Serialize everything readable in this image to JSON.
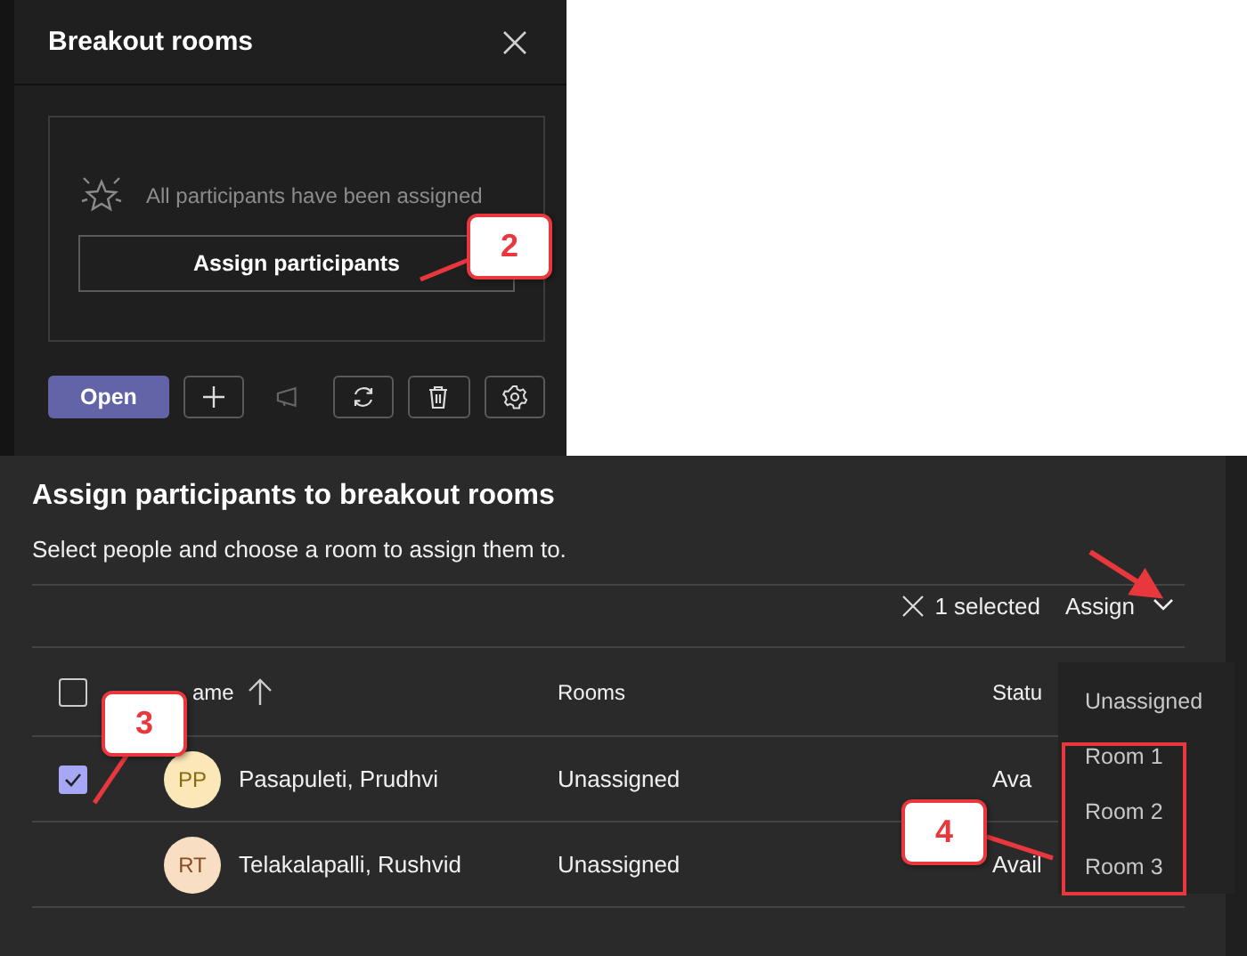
{
  "breakout_panel": {
    "title": "Breakout rooms",
    "empty_message": "All participants have been assigned",
    "assign_button": "Assign participants",
    "open_button": "Open"
  },
  "assign_dialog": {
    "title": "Assign participants to breakout rooms",
    "subtitle": "Select people and choose a room to assign them to.",
    "selection_count": "1 selected",
    "assign_button": "Assign",
    "select_all_checked": false,
    "columns": [
      "ame",
      "Rooms",
      "Statu"
    ],
    "rows": [
      {
        "initials": "PP",
        "color": "#fbe7b8",
        "name": "Pasapuleti, Prudhvi",
        "room": "Unassigned",
        "status": "Ava",
        "checked": true
      },
      {
        "initials": "RT",
        "color": "#f8dfc4",
        "name": "Telakalapalli, Rushvid",
        "room": "Unassigned",
        "status": "Avail",
        "checked": false
      }
    ],
    "menu": {
      "items": [
        "Unassigned",
        "Room 1",
        "Room 2",
        "Room 3"
      ]
    }
  },
  "annotations": [
    {
      "label": "2"
    },
    {
      "label": "3"
    },
    {
      "label": "4"
    }
  ]
}
